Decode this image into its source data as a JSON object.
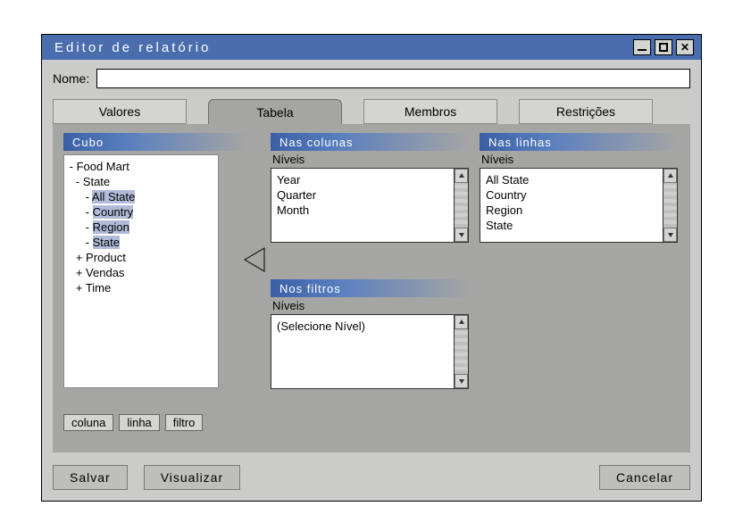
{
  "window": {
    "title": "Editor de relatório"
  },
  "name_row": {
    "label": "Nome:",
    "value": ""
  },
  "tabs": {
    "valores": "Valores",
    "tabela": "Tabela",
    "membros": "Membros",
    "restricoes": "Restrições",
    "active": "tabela"
  },
  "sections": {
    "cubo": {
      "header": "Cubo"
    },
    "columns": {
      "header": "Nas colunas",
      "levels_label": "Níveis",
      "items": [
        "Year",
        "Quarter",
        "Month"
      ]
    },
    "rows": {
      "header": "Nas linhas",
      "levels_label": "Níveis",
      "items": [
        "All State",
        "Country",
        "Region",
        "State"
      ]
    },
    "filters": {
      "header": "Nos filtros",
      "levels_label": "Níveis",
      "placeholder": "(Selecione Nível)"
    }
  },
  "tree": {
    "root": "Food Mart",
    "state_label": "State",
    "children": [
      "All State",
      "Country",
      "Region",
      "State"
    ],
    "siblings_plus": [
      "Product",
      "Vendas",
      "Time"
    ]
  },
  "mini_buttons": {
    "coluna": "coluna",
    "linha": "linha",
    "filtro": "filtro"
  },
  "footer": {
    "salvar": "Salvar",
    "visualizar": "Visualizar",
    "cancelar": "Cancelar"
  }
}
